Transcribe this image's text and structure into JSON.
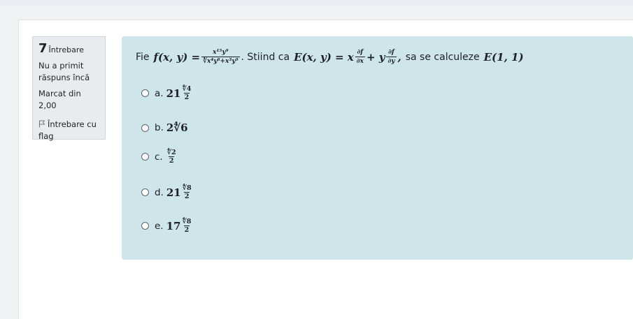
{
  "info": {
    "number": "7",
    "question_word": "Întrebare",
    "status": "Nu a primit răspuns încă",
    "mark": "Marcat din 2,00",
    "flag_label": "Întrebare cu flag"
  },
  "question": {
    "prefix": "Fie",
    "f_lhs": "f(x, y) =",
    "f_num": "x¹⁵y⁹",
    "f_den": "∜x⁴y⁸+x³y⁹",
    "mid": ". Stiind ca",
    "e_lhs": "E(x, y) = x",
    "df": "∂f",
    "dx": "∂x",
    "plus_y": "+ y",
    "dy": "∂y",
    "comma": ",",
    "suffix": "sa se calculeze",
    "target": "E(1, 1)"
  },
  "answers": [
    {
      "label": "a.",
      "whole": "21",
      "num": "∜4",
      "den": "2",
      "expr": ""
    },
    {
      "label": "b.",
      "whole": "",
      "num": "",
      "den": "",
      "expr": "2∜6"
    },
    {
      "label": "c.",
      "whole": "",
      "num": "∜2",
      "den": "2",
      "expr": ""
    },
    {
      "label": "d.",
      "whole": "21",
      "num": "∜8",
      "den": "2",
      "expr": ""
    },
    {
      "label": "e.",
      "whole": "17",
      "num": "∜8",
      "den": "2",
      "expr": ""
    }
  ]
}
